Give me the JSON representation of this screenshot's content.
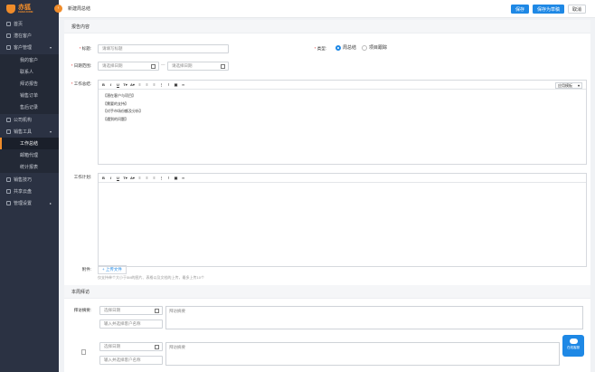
{
  "sidebar": {
    "brand": "赤狐",
    "brand_sub": "CHIHUCRM",
    "items": [
      {
        "label": "首页"
      },
      {
        "label": "潜在客户"
      },
      {
        "label": "客户管理"
      },
      {
        "label": "我的客户"
      },
      {
        "label": "联系人"
      },
      {
        "label": "拜访报告"
      },
      {
        "label": "销售订单"
      },
      {
        "label": "售后记录"
      },
      {
        "label": "公司机构"
      },
      {
        "label": "销售工具"
      },
      {
        "label": "工作总结"
      },
      {
        "label": "邮箱代理"
      },
      {
        "label": "统计报表"
      },
      {
        "label": "销售技巧"
      },
      {
        "label": "共享云盘"
      },
      {
        "label": "管理设置"
      }
    ]
  },
  "header": {
    "title": "新建周总结",
    "save": "保存",
    "save_draft": "保存为草稿",
    "cancel": "取消"
  },
  "form": {
    "section_report": "报告内容",
    "title_label": "标题:",
    "title_placeholder": "请填写标题",
    "type_label": "类型:",
    "type_weekly": "周总结",
    "type_project": "项目跟踪",
    "date_label": "日期范围:",
    "date_start_placeholder": "请选择日期",
    "date_sep": "—",
    "date_end_placeholder": "请选择日期",
    "summary_label": "工作总结:",
    "summary_lines": [
      "【潜在客户与项目】",
      "【需要的支持】",
      "【对手市场份额及分析】",
      "【遇到的问题】"
    ],
    "toolbar_select": "应用模板",
    "plan_label": "工作计划:",
    "attach_label": "附件:",
    "upload_btn": "+ 上传文件",
    "upload_hint": "仅支持单个大小于5M的图片、表格以及文档的上传，最多上传10个",
    "section_visits": "本周拜访",
    "visit_label": "拜访摘要:",
    "visit_date_placeholder": "选择日期",
    "visit_customer_placeholder": "输入并选择客户名称",
    "visit_summary_placeholder": "拜访摘要"
  },
  "help": {
    "label": "在线客服"
  },
  "colors": {
    "accent": "#1e88e5",
    "brand": "#f08c2a",
    "sidebar_bg": "#2b3243"
  }
}
